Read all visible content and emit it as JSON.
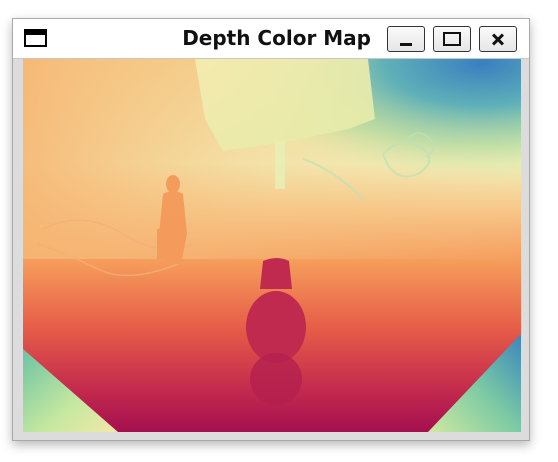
{
  "window": {
    "title": "Depth Color Map",
    "icon": "window-icon",
    "controls": {
      "minimize": "minimize-icon",
      "maximize": "maximize-icon",
      "close": "close-icon"
    }
  },
  "depth_map": {
    "colormap": "spectral",
    "colors": {
      "near": "#a80f4f",
      "mid_near": "#e85a45",
      "mid": "#f8a55c",
      "mid_far": "#f0f0b0",
      "far": "#7ccaa4",
      "farthest": "#2e73b7"
    }
  }
}
